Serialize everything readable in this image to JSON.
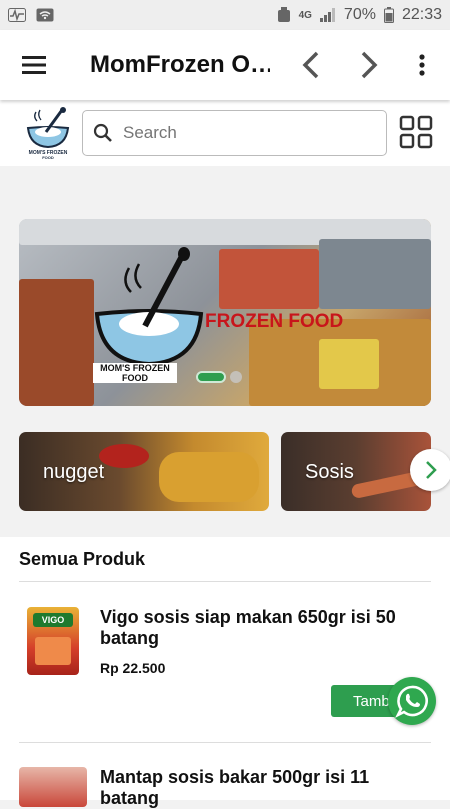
{
  "status_bar": {
    "battery": "70%",
    "time": "22:33",
    "network": "4G"
  },
  "app_bar": {
    "title": "MomFrozen O…",
    "icons": [
      "menu-icon",
      "back-icon",
      "forward-icon",
      "more-vert-icon"
    ]
  },
  "search": {
    "placeholder": "Search"
  },
  "banner": {
    "text": "FROZEN FOOD",
    "brand": "MOM'S FROZEN FOOD"
  },
  "categories": [
    {
      "label": "nugget"
    },
    {
      "label": "Sosis"
    }
  ],
  "products_section": {
    "heading": "Semua Produk",
    "items": [
      {
        "name": "Vigo sosis siap makan 650gr isi 50 batang",
        "price": "Rp 22.500",
        "button": "Tambah"
      },
      {
        "name": "Mantap sosis bakar 500gr isi 11 batang"
      }
    ]
  },
  "colors": {
    "accent": "#2e9e4f",
    "banner_text": "#c8151b"
  }
}
